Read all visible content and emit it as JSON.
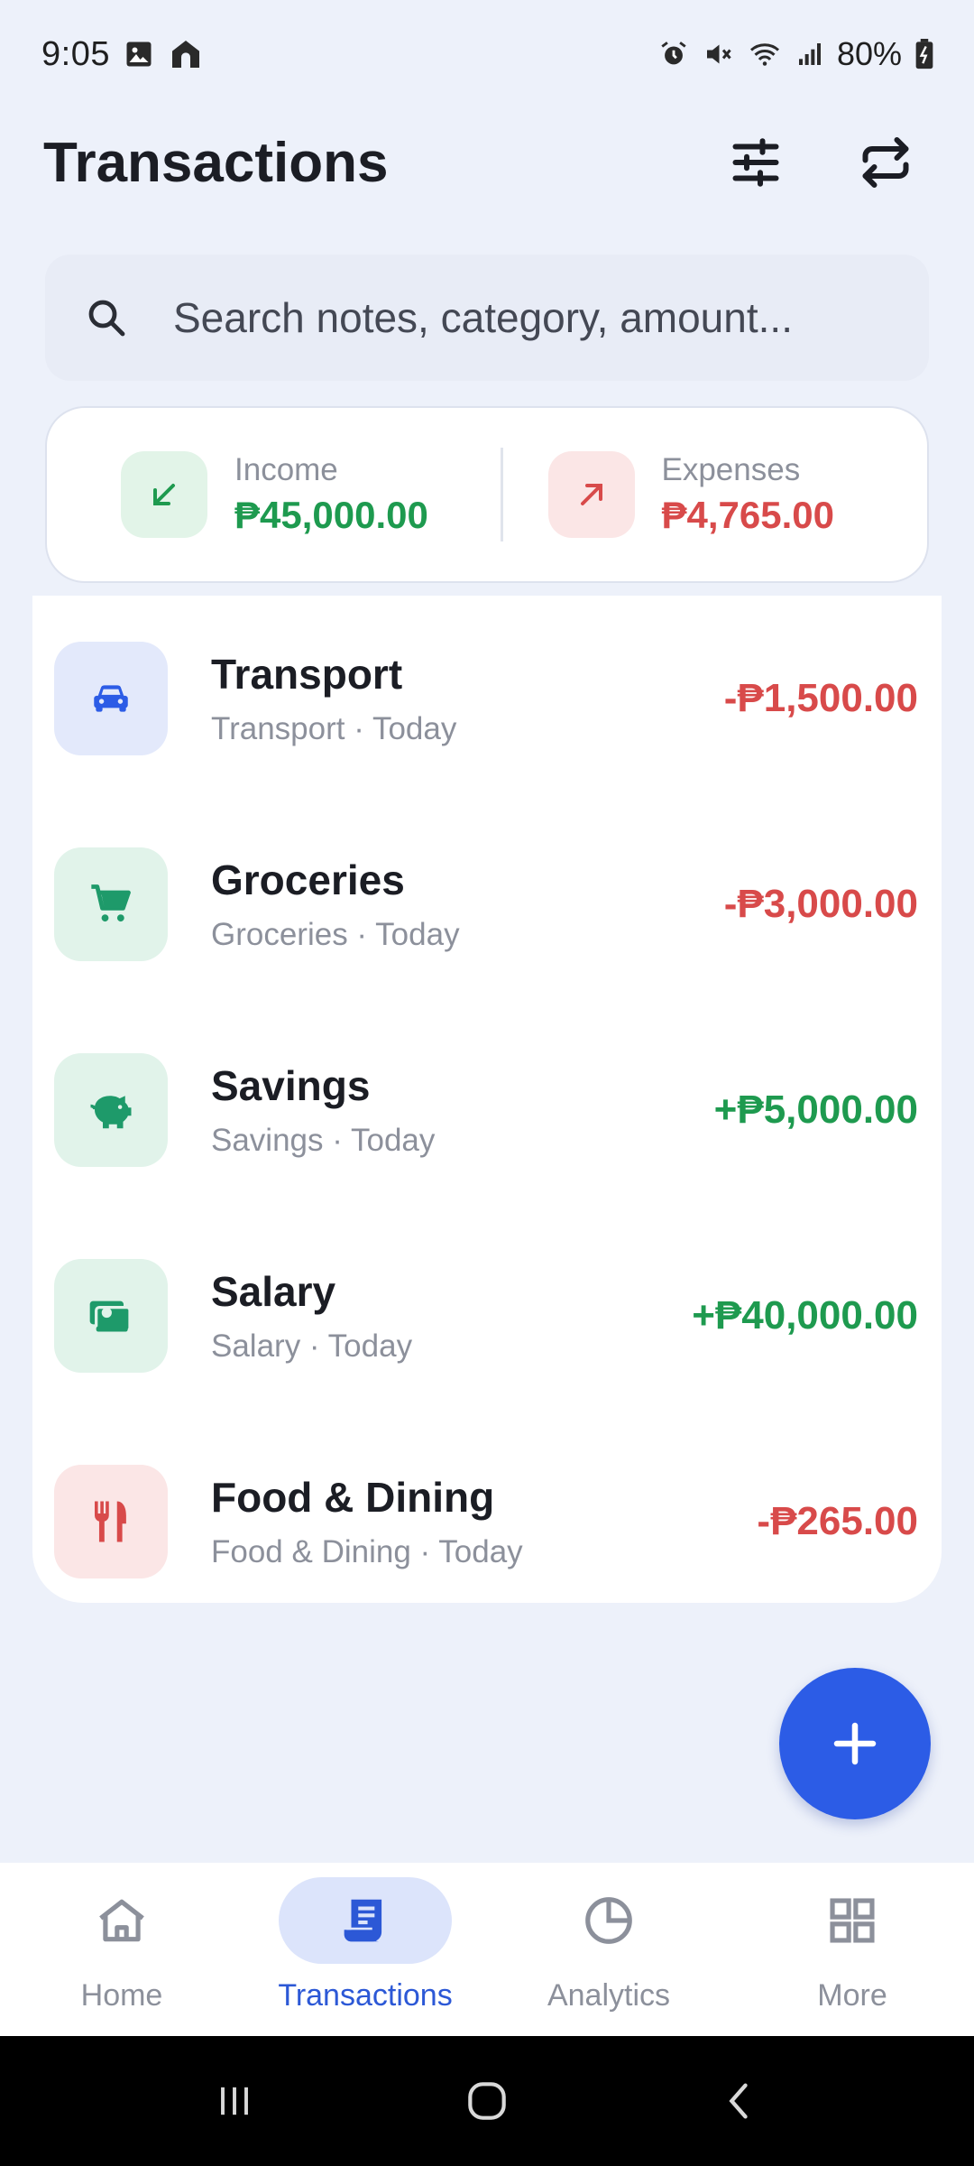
{
  "status_bar": {
    "time": "9:05",
    "battery": "80%",
    "icons": [
      "gallery-icon",
      "home-app-icon",
      "alarm-icon",
      "mute-icon",
      "wifi-icon",
      "signal-icon",
      "battery-icon"
    ]
  },
  "header": {
    "title": "Transactions",
    "filter_icon": "sliders-icon",
    "switch_icon": "repeat-icon"
  },
  "search": {
    "placeholder": "Search notes, category, amount..."
  },
  "summary": {
    "income": {
      "label": "Income",
      "value": "₱45,000.00",
      "color": "#1e9a4f"
    },
    "expenses": {
      "label": "Expenses",
      "value": "₱4,765.00",
      "color": "#d84a4a"
    }
  },
  "transactions": [
    {
      "title": "Transport",
      "subtitle": "Transport · Today",
      "amount": "-₱1,500.00",
      "type": "expense",
      "icon": "car-icon"
    },
    {
      "title": "Groceries",
      "subtitle": "Groceries · Today",
      "amount": "-₱3,000.00",
      "type": "expense",
      "icon": "cart-icon"
    },
    {
      "title": "Savings",
      "subtitle": "Savings · Today",
      "amount": "+₱5,000.00",
      "type": "income",
      "icon": "piggy-bank-icon"
    },
    {
      "title": "Salary",
      "subtitle": "Salary · Today",
      "amount": "+₱40,000.00",
      "type": "income",
      "icon": "cash-icon"
    },
    {
      "title": "Food & Dining",
      "subtitle": "Food & Dining · Today",
      "amount": "-₱265.00",
      "type": "expense",
      "icon": "utensils-icon"
    }
  ],
  "fab": {
    "icon": "plus-icon"
  },
  "bottom_nav": [
    {
      "label": "Home",
      "icon": "home-icon",
      "active": false
    },
    {
      "label": "Transactions",
      "icon": "receipt-icon",
      "active": true
    },
    {
      "label": "Analytics",
      "icon": "pie-chart-icon",
      "active": false
    },
    {
      "label": "More",
      "icon": "grid-icon",
      "active": false
    }
  ],
  "colors": {
    "accent": "#2c5ce6",
    "income": "#1e9a4f",
    "expense": "#d84a4a",
    "background": "#edf1fa"
  }
}
